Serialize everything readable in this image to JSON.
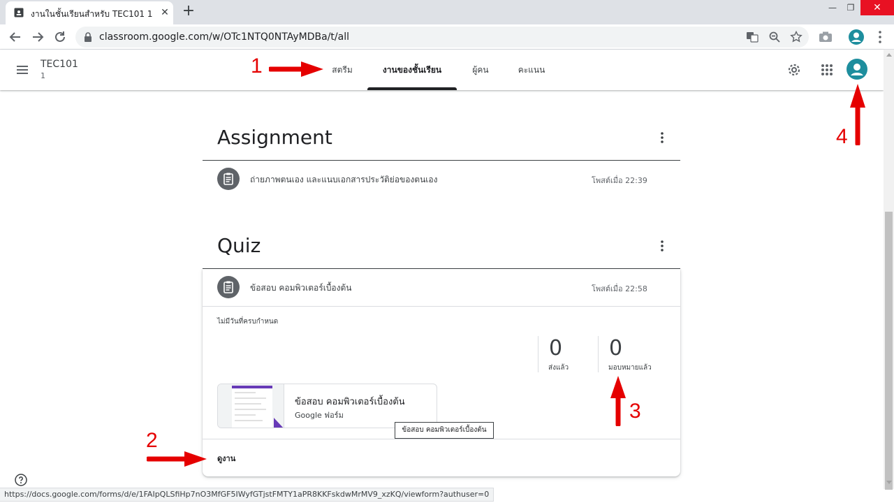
{
  "browser": {
    "tab_title": "งานในชั้นเรียนสำหรับ TEC101 1",
    "url": "classroom.google.com/w/OTc1NTQ0NTAyMDBa/t/all",
    "window_buttons": {
      "minimize": "—",
      "maximize": "❐",
      "close": "✕"
    },
    "status_url": "https://docs.google.com/forms/d/e/1FAIpQLSfiHp7nO3MfGF5IWyfGTjstFMTY1aPR8KKFskdwMrMV9_xzKQ/viewform?authuser=0"
  },
  "header": {
    "class_name": "TEC101",
    "class_section": "1",
    "tabs": [
      {
        "label": "สตรีม",
        "active": false
      },
      {
        "label": "งานของชั้นเรียน",
        "active": true
      },
      {
        "label": "ผู้คน",
        "active": false
      },
      {
        "label": "คะแนน",
        "active": false
      }
    ]
  },
  "topics": [
    {
      "title": "Assignment",
      "items": [
        {
          "title": "ถ่ายภาพตนเอง และแนบเอกสารประวัติย่อของตนเอง",
          "time": "โพสต์เมื่อ 22:39"
        }
      ]
    },
    {
      "title": "Quiz",
      "items": [
        {
          "title": "ข้อสอบ คอมพิวเตอร์เบื้องต้น",
          "time": "โพสต์เมื่อ 22:58",
          "due": "ไม่มีวันที่ครบกำหนด",
          "turned_in_count": "0",
          "turned_in_label": "ส่งแล้ว",
          "assigned_count": "0",
          "assigned_label": "มอบหมายแล้ว",
          "attachment": {
            "title": "ข้อสอบ คอมพิวเตอร์เบื้องต้น",
            "type": "Google ฟอร์ม"
          },
          "view_link": "ดูงาน"
        }
      ]
    }
  ],
  "tooltip": "ข้อสอบ คอมพิวเตอร์เบื้องต้น",
  "annotations": [
    "1",
    "2",
    "3",
    "4"
  ],
  "colors": {
    "annotation": "#e50000",
    "avatar": "#1e8e9e",
    "accent": "#202124"
  }
}
